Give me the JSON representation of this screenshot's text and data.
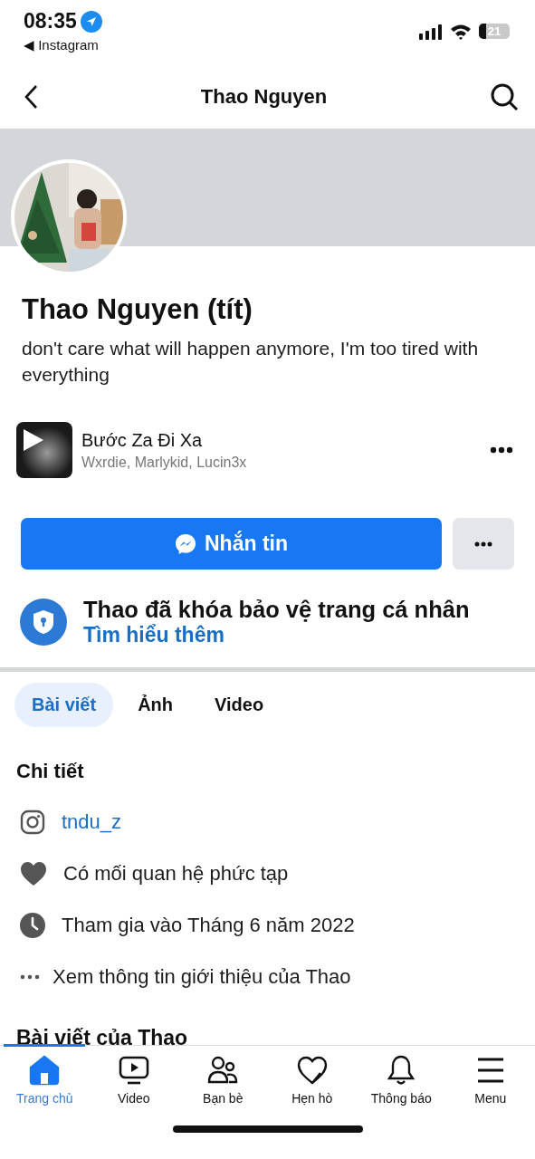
{
  "status_bar": {
    "time": "08:35",
    "back_app": "◀ Instagram",
    "battery": "21"
  },
  "nav": {
    "title": "Thao Nguyen"
  },
  "profile": {
    "name": "Thao Nguyen (tít)",
    "bio": "don't care what will happen anymore, I'm too tired with everything"
  },
  "music": {
    "title": "Bước Za Đi Xa",
    "artists": "Wxrdie, Marlykid, Lucin3x"
  },
  "actions": {
    "message": "Nhắn tin"
  },
  "lock_notice": {
    "title": "Thao đã khóa bảo vệ trang cá nhân",
    "link": "Tìm hiểu thêm"
  },
  "tabs": [
    {
      "label": "Bài viết",
      "selected": true
    },
    {
      "label": "Ảnh",
      "selected": false
    },
    {
      "label": "Video",
      "selected": false
    }
  ],
  "details": {
    "title": "Chi tiết",
    "items": [
      {
        "kind": "instagram",
        "text": "tndu_z"
      },
      {
        "kind": "relationship",
        "text": "Có mối quan hệ phức tạp"
      },
      {
        "kind": "joined",
        "text": "Tham gia vào Tháng 6 năm 2022"
      },
      {
        "kind": "more",
        "text": "Xem thông tin giới thiệu của Thao"
      }
    ]
  },
  "posts_heading": "Bài viết của Thao",
  "tab_bar": [
    {
      "kind": "home",
      "label": "Trang chủ",
      "selected": true
    },
    {
      "kind": "video",
      "label": "Video",
      "selected": false
    },
    {
      "kind": "friends",
      "label": "Bạn bè",
      "selected": false
    },
    {
      "kind": "dating",
      "label": "Hẹn hò",
      "selected": false
    },
    {
      "kind": "bell",
      "label": "Thông báo",
      "selected": false
    },
    {
      "kind": "menu",
      "label": "Menu",
      "selected": false
    }
  ]
}
